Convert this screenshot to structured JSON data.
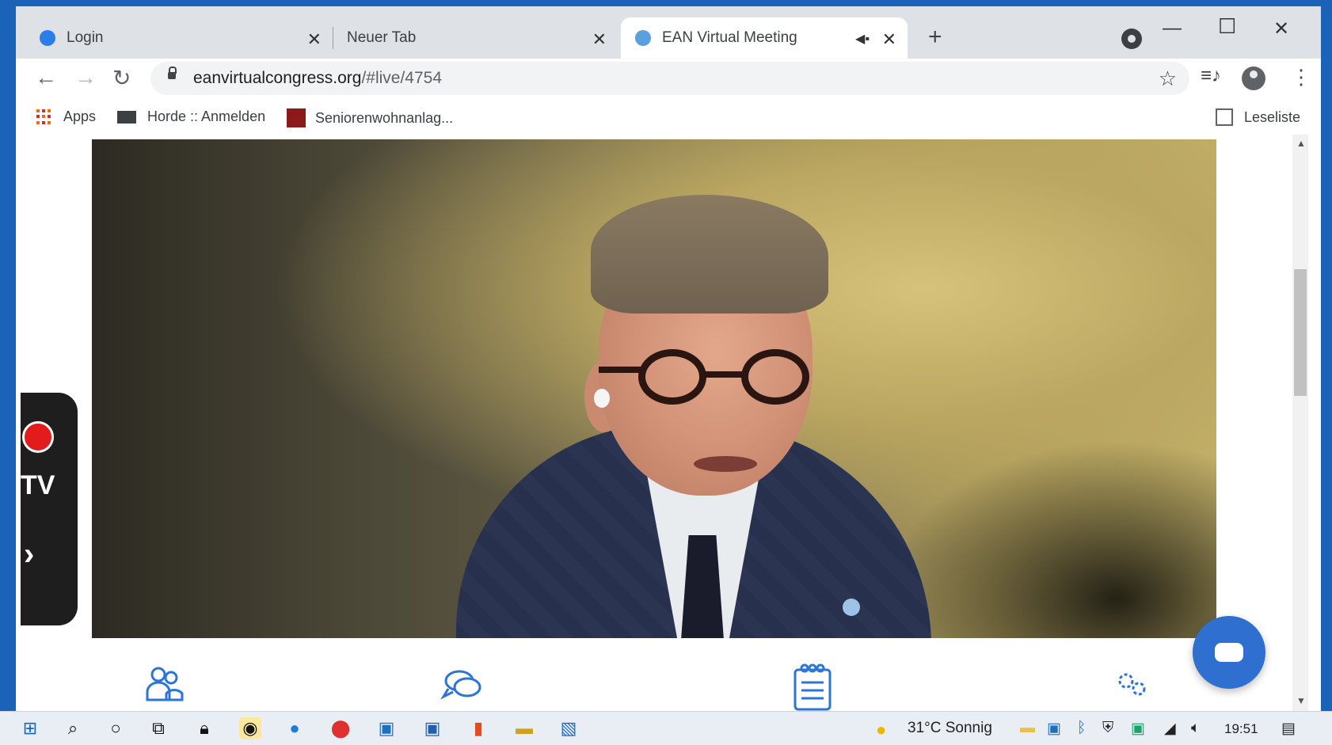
{
  "browser": {
    "tabs": [
      {
        "label": "Login"
      },
      {
        "label": "Neuer Tab"
      },
      {
        "label": "EAN Virtual Meeting"
      }
    ],
    "url_host": "eanvirtualcongress.org",
    "url_path": "/#live/4754",
    "bookmarks": [
      {
        "label": "Apps"
      },
      {
        "label": "Horde :: Anmelden"
      },
      {
        "label": "Seniorenwohnanlag..."
      }
    ],
    "reading_list_label": "Leseliste"
  },
  "page": {
    "tv_label": "TV",
    "tv_arrow": "›",
    "colors": {
      "accent": "#2c74d6",
      "record": "#e21b1b",
      "panel": "#1e1e1e"
    }
  },
  "taskbar": {
    "weather": "31°C  Sonnig",
    "time": "19:51"
  },
  "icons": {
    "bottom_bar": [
      "attendees-icon",
      "chat-icon",
      "agenda-icon",
      "settings-icon"
    ]
  }
}
